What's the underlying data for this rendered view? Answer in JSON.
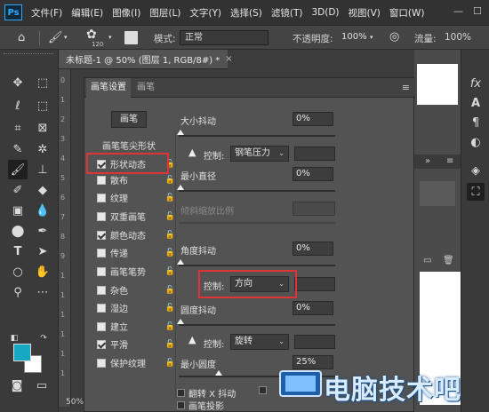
{
  "menubar": {
    "logo": "Ps",
    "items": [
      "文件(F)",
      "编辑(E)",
      "图像(I)",
      "图层(L)",
      "文字(Y)",
      "选择(S)",
      "滤镜(T)",
      "3D(D)",
      "视图(V)",
      "窗口(W)"
    ],
    "window_controls": [
      "—",
      "☐"
    ]
  },
  "options": {
    "brush_size": "120",
    "mode_label": "模式:",
    "mode_value": "正常",
    "opacity_label": "不透明度:",
    "opacity_value": "100%",
    "flow_label": "流量:",
    "flow_value": "100%"
  },
  "document": {
    "tab_title": "未标题-1 @ 50% (图层 1, RGB/8#) *",
    "close": "×",
    "zoom": "50%",
    "ruler_marks": [
      "0",
      "1",
      "2",
      "3",
      "4",
      "5",
      "6",
      "7",
      "8",
      "9",
      "1",
      "1",
      "1",
      "1",
      "1",
      "1"
    ]
  },
  "brush_panel": {
    "tabs": [
      "画笔设置",
      "画笔"
    ],
    "brush_button": "画笔",
    "tip_shape": "画笔笔尖形状",
    "options": [
      {
        "label": "形状动态",
        "checked": true
      },
      {
        "label": "散布",
        "checked": false
      },
      {
        "label": "纹理",
        "checked": false
      },
      {
        "label": "双重画笔",
        "checked": false
      },
      {
        "label": "颜色动态",
        "checked": true
      },
      {
        "label": "传递",
        "checked": false
      },
      {
        "label": "画笔笔势",
        "checked": false
      },
      {
        "label": "杂色",
        "checked": false
      },
      {
        "label": "湿边",
        "checked": false
      },
      {
        "label": "建立",
        "checked": false
      },
      {
        "label": "平滑",
        "checked": true
      },
      {
        "label": "保护纹理",
        "checked": false
      }
    ],
    "size_jitter_label": "大小抖动",
    "size_jitter_value": "0%",
    "control_label": "控制:",
    "control1_value": "钢笔压力",
    "min_diameter_label": "最小直径",
    "min_diameter_value": "0%",
    "tilt_scale_label": "倾斜缩放比例",
    "angle_jitter_label": "角度抖动",
    "angle_jitter_value": "0%",
    "control2_value": "方向",
    "roundness_jitter_label": "圆度抖动",
    "roundness_jitter_value": "0%",
    "control3_value": "旋转",
    "min_roundness_label": "最小圆度",
    "min_roundness_value": "25%",
    "flip_x_label": "翻转 X 抖动",
    "brush_projection_label": "画笔投影"
  },
  "watermark": {
    "text": "电脑技术吧"
  },
  "colors": {
    "foreground": "#17a9c4",
    "background": "#ffffff",
    "highlight": "#e03434"
  }
}
